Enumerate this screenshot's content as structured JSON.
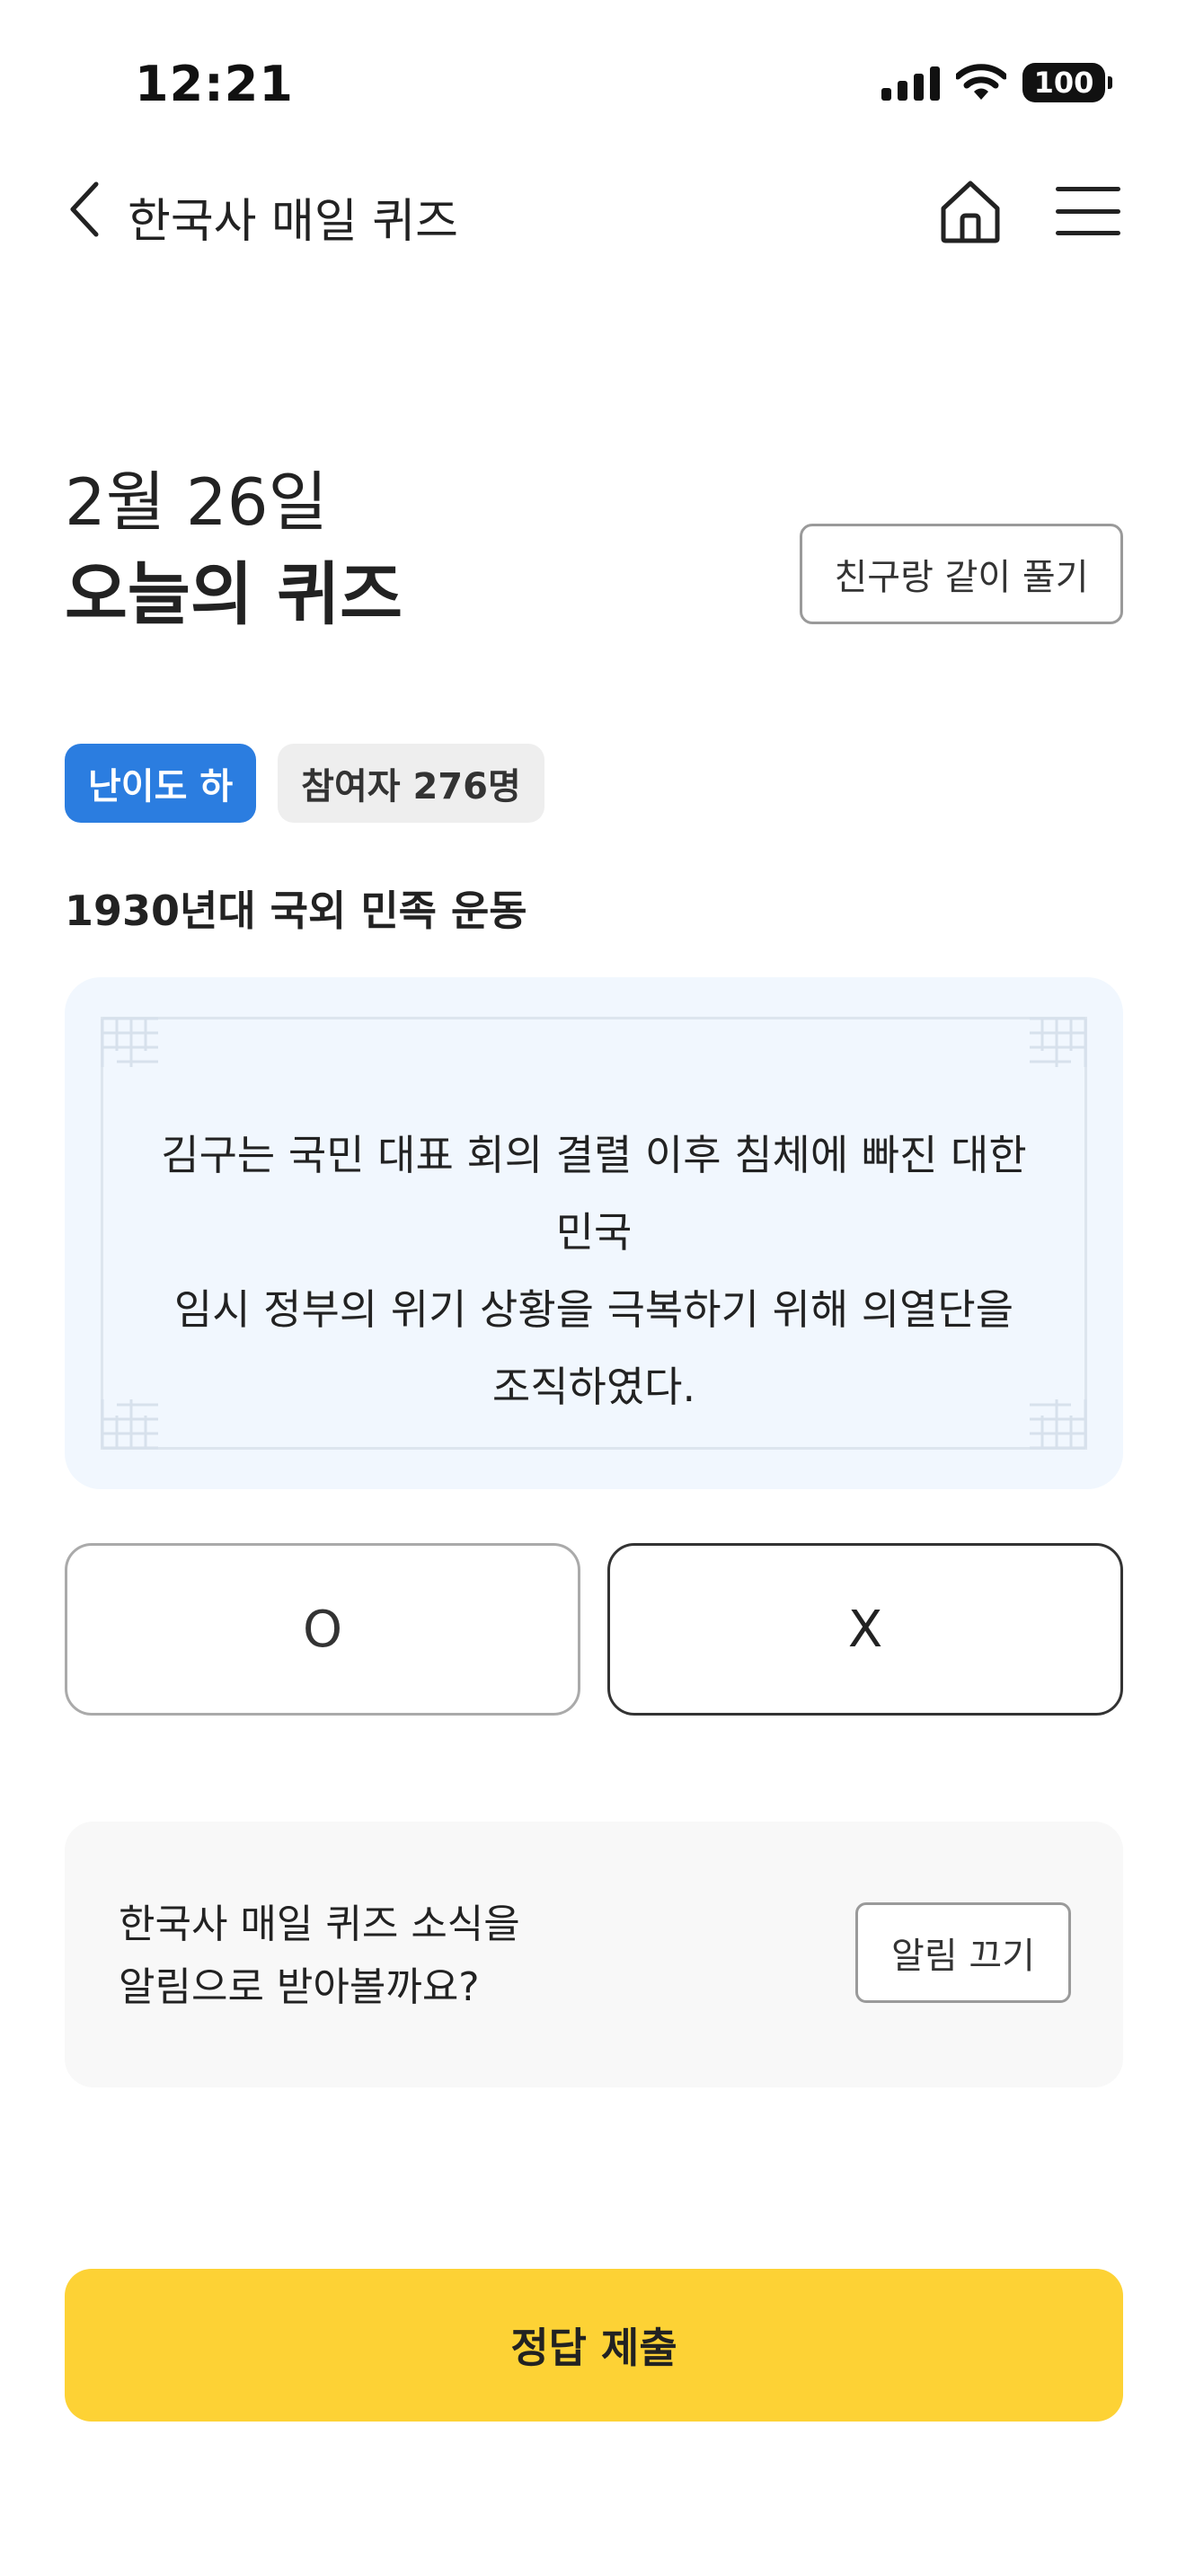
{
  "status_bar": {
    "time": "12:21",
    "battery": "100",
    "icons": [
      "signal-icon",
      "wifi-icon",
      "battery-icon"
    ]
  },
  "nav": {
    "title": "한국사 매일 퀴즈",
    "icons": [
      "back-chevron-icon",
      "home-icon",
      "menu-icon"
    ]
  },
  "header": {
    "date": "2월 26일",
    "title": "오늘의 퀴즈",
    "share_button": "친구랑 같이 풀기"
  },
  "badges": {
    "level": "난이도 하",
    "participants": "참여자 276명"
  },
  "quiz": {
    "topic": "1930년대 국외 민족 운동",
    "question_lines": [
      "김구는 국민 대표 회의 결렬 이후 침체에 빠진 대한민국",
      "임시 정부의 위기 상황을 극복하기 위해 의열단을",
      "조직하였다."
    ],
    "options": {
      "o": "O",
      "x": "X"
    }
  },
  "notification": {
    "line1": "한국사 매일 퀴즈 소식을",
    "line2": "알림으로 받아볼까요?",
    "button": "알림 끄기"
  },
  "submit": {
    "label": "정답 제출"
  },
  "colors": {
    "accent_yellow": "#fdd235",
    "level_badge_blue": "#2b7de0",
    "question_card_bg": "#f1f7fe"
  }
}
